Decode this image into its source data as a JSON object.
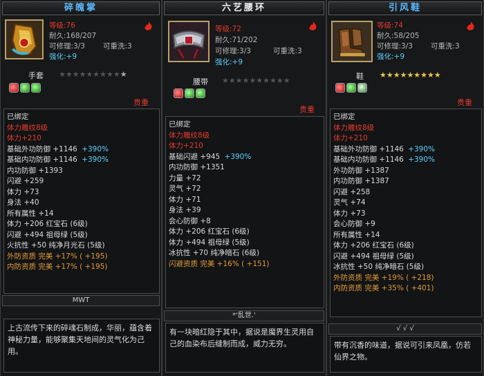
{
  "panels": [
    {
      "title": "碎魄掌",
      "name_label": "手套",
      "header": [
        {
          "text": "等级:76",
          "color": "red"
        },
        {
          "text": "耐久:168/207",
          "color": "grey"
        },
        {
          "text": "可修理:3/3",
          "color": "grey"
        },
        {
          "text": "可重洗:3",
          "color": "grey"
        },
        {
          "text": "强化:+9",
          "color": "cyan"
        }
      ],
      "stars": {
        "filled": 0,
        "total": 9,
        "extra": 1
      },
      "gems": [
        "r",
        "g",
        "g"
      ],
      "precious": "贵重",
      "props": [
        [
          {
            "t": "已绑定",
            "c": "w"
          }
        ],
        [
          {
            "t": "体力雕纹8级",
            "c": "r"
          }
        ],
        [
          {
            "t": "体力+210",
            "c": "r"
          }
        ],
        [
          {
            "t": "基础外功防御 +1146 ",
            "c": "w"
          },
          {
            "t": "+390%",
            "c": "c"
          }
        ],
        [
          {
            "t": "基础内功防御 +1146 ",
            "c": "w"
          },
          {
            "t": "+390%",
            "c": "c"
          }
        ],
        [
          {
            "t": "内功防御 +1393",
            "c": "w"
          }
        ],
        [
          {
            "t": "闪避 +259",
            "c": "w"
          }
        ],
        [
          {
            "t": "体力 +73",
            "c": "w"
          }
        ],
        [
          {
            "t": "身法 +40",
            "c": "w"
          }
        ],
        [
          {
            "t": "所有属性 +14",
            "c": "w"
          }
        ],
        [
          {
            "t": "体力 +206 红宝石 (6级)",
            "c": "w"
          }
        ],
        [
          {
            "t": "闪避 +494 祖母绿 (5级)",
            "c": "w"
          }
        ],
        [
          {
            "t": "火抗性 +50 纯净月光石 (5级)",
            "c": "w"
          }
        ],
        [
          {
            "t": "外防资质  完美 +17% ( +195)",
            "c": "o"
          }
        ],
        [
          {
            "t": "内防资质  完美 +17% ( +195)",
            "c": "o"
          }
        ]
      ],
      "separator": "MWT",
      "description": "上古流传下来的碎魂石制成，华丽，蕴含着神秘力量，能够聚集天地间的灵气化为己用。"
    },
    {
      "title": "六艺腰环",
      "name_label": "腰带",
      "header": [
        {
          "text": "等级:72",
          "color": "red"
        },
        {
          "text": "耐久:71/202",
          "color": "grey"
        },
        {
          "text": "可修理:3/3",
          "color": "grey"
        },
        {
          "text": "可重洗:3",
          "color": "grey"
        },
        {
          "text": "强化:+9",
          "color": "cyan"
        }
      ],
      "stars": {
        "filled": 0,
        "total": 10,
        "extra": 0
      },
      "gems": [
        "r",
        "g",
        "g"
      ],
      "precious": "贵重",
      "props": [
        [
          {
            "t": "已绑定",
            "c": "w"
          }
        ],
        [
          {
            "t": "体力雕纹8级",
            "c": "r"
          }
        ],
        [
          {
            "t": "体力+210",
            "c": "r"
          }
        ],
        [
          {
            "t": "基础闪避 +945 ",
            "c": "w"
          },
          {
            "t": "+390%",
            "c": "c"
          }
        ],
        [
          {
            "t": "内功防御 +1351",
            "c": "w"
          }
        ],
        [
          {
            "t": "力量 +72",
            "c": "w"
          }
        ],
        [
          {
            "t": "灵气 +72",
            "c": "w"
          }
        ],
        [
          {
            "t": "体力 +71",
            "c": "w"
          }
        ],
        [
          {
            "t": "身法 +39",
            "c": "w"
          }
        ],
        [
          {
            "t": "会心防御 +8",
            "c": "w"
          }
        ],
        [
          {
            "t": "体力 +206 红宝石 (6级)",
            "c": "w"
          }
        ],
        [
          {
            "t": "体力 +494 祖母绿 (5级)",
            "c": "w"
          }
        ],
        [
          {
            "t": "冰抗性 +70 纯净暗石 (6级)",
            "c": "w"
          }
        ],
        [
          {
            "t": "闪避资质  完美 +16% ( +151)",
            "c": "o"
          }
        ]
      ],
      "separator": "*'乱世.'",
      "description": "有一块暗红隐于其中，据说是魔界生灵用自己的血染布后缝制而成，威力无穷。"
    },
    {
      "title": "引风鞋",
      "name_label": "鞋",
      "header": [
        {
          "text": "等级:74",
          "color": "red"
        },
        {
          "text": "耐久:58/205",
          "color": "grey"
        },
        {
          "text": "可修理:3/3",
          "color": "grey"
        },
        {
          "text": "可重洗:3",
          "color": "grey"
        },
        {
          "text": "强化:+9",
          "color": "cyan"
        }
      ],
      "stars": {
        "filled": 9,
        "total": 9,
        "extra": 0
      },
      "gems": [
        "r",
        "g",
        "w"
      ],
      "precious": "贵重",
      "props": [
        [
          {
            "t": "已绑定",
            "c": "w"
          }
        ],
        [
          {
            "t": "体力雕纹8级",
            "c": "r"
          }
        ],
        [
          {
            "t": "体力+210",
            "c": "r"
          }
        ],
        [
          {
            "t": "基础外功防御 +1146 ",
            "c": "w"
          },
          {
            "t": "+390%",
            "c": "c"
          }
        ],
        [
          {
            "t": "基础内功防御 +1146 ",
            "c": "w"
          },
          {
            "t": "+390%",
            "c": "c"
          }
        ],
        [
          {
            "t": "外功防御 +1387",
            "c": "w"
          }
        ],
        [
          {
            "t": "内功防御 +1387",
            "c": "w"
          }
        ],
        [
          {
            "t": "闪避 +258",
            "c": "w"
          }
        ],
        [
          {
            "t": "灵气 +74",
            "c": "w"
          }
        ],
        [
          {
            "t": "体力 +73",
            "c": "w"
          }
        ],
        [
          {
            "t": "会心防御 +9",
            "c": "w"
          }
        ],
        [
          {
            "t": "所有属性 +14",
            "c": "w"
          }
        ],
        [
          {
            "t": "体力 +206 红宝石 (6级)",
            "c": "w"
          }
        ],
        [
          {
            "t": "闪避 +494 祖母绿 (5级)",
            "c": "w"
          }
        ],
        [
          {
            "t": "冰抗性 +50 纯净暗石 (5级)",
            "c": "w"
          }
        ],
        [
          {
            "t": "外防资质  完美 +19% ( +218)",
            "c": "o"
          }
        ],
        [
          {
            "t": "内防资质  完美 +35% ( +401)",
            "c": "o"
          }
        ]
      ],
      "separator": "√ √ √",
      "description": "带有沉香的味道，据说可引来凤凰，仿若仙界之物。"
    }
  ],
  "colors": {
    "title_blue": "#5ab9ff",
    "red": "#e33a2e",
    "cyan": "#5fd0ff",
    "orange": "#e39a3a",
    "star": "#e8c64a"
  }
}
